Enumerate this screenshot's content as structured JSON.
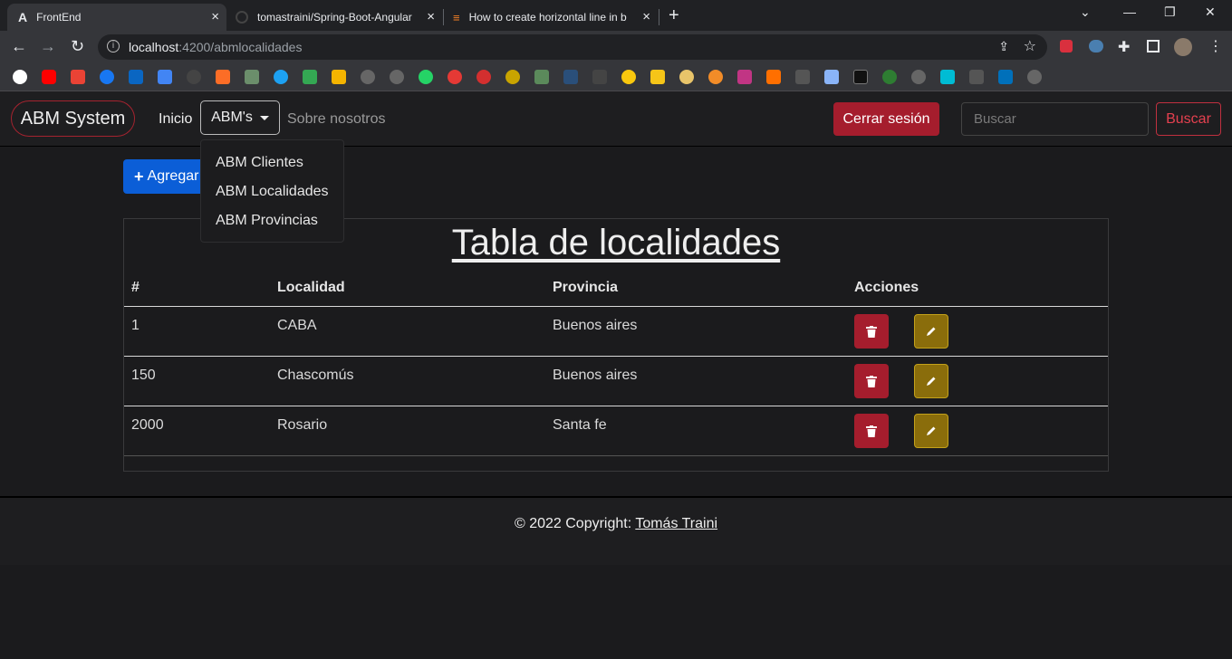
{
  "browser": {
    "tabs": [
      {
        "title": "FrontEnd"
      },
      {
        "title": "tomastraini/Spring-Boot-Angular"
      },
      {
        "title": "How to create horizontal line in b"
      }
    ],
    "url_host": "localhost",
    "url_path": ":4200/abmlocalidades"
  },
  "navbar": {
    "brand": "ABM System",
    "inicio": "Inicio",
    "abms": "ABM's",
    "sobre": "Sobre nosotros",
    "logout": "Cerrar sesión",
    "search_placeholder": "Buscar",
    "search_button": "Buscar"
  },
  "dropdown": {
    "items": [
      "ABM Clientes",
      "ABM Localidades",
      "ABM Provincias"
    ]
  },
  "main": {
    "add_button": "Agregar",
    "table_title": "Tabla de localidades",
    "columns": [
      "#",
      "Localidad",
      "Provincia",
      "Acciones"
    ],
    "rows": [
      {
        "id": "1",
        "localidad": "CABA",
        "provincia": "Buenos aires"
      },
      {
        "id": "150",
        "localidad": "Chascomús",
        "provincia": "Buenos aires"
      },
      {
        "id": "2000",
        "localidad": "Rosario",
        "provincia": "Santa fe"
      }
    ]
  },
  "footer": {
    "prefix": "© 2022 Copyright: ",
    "author": "Tomás Traini"
  },
  "colors": {
    "danger": "#a51d2d",
    "warning": "#8a6d0b",
    "primary": "#0b5ed7"
  }
}
